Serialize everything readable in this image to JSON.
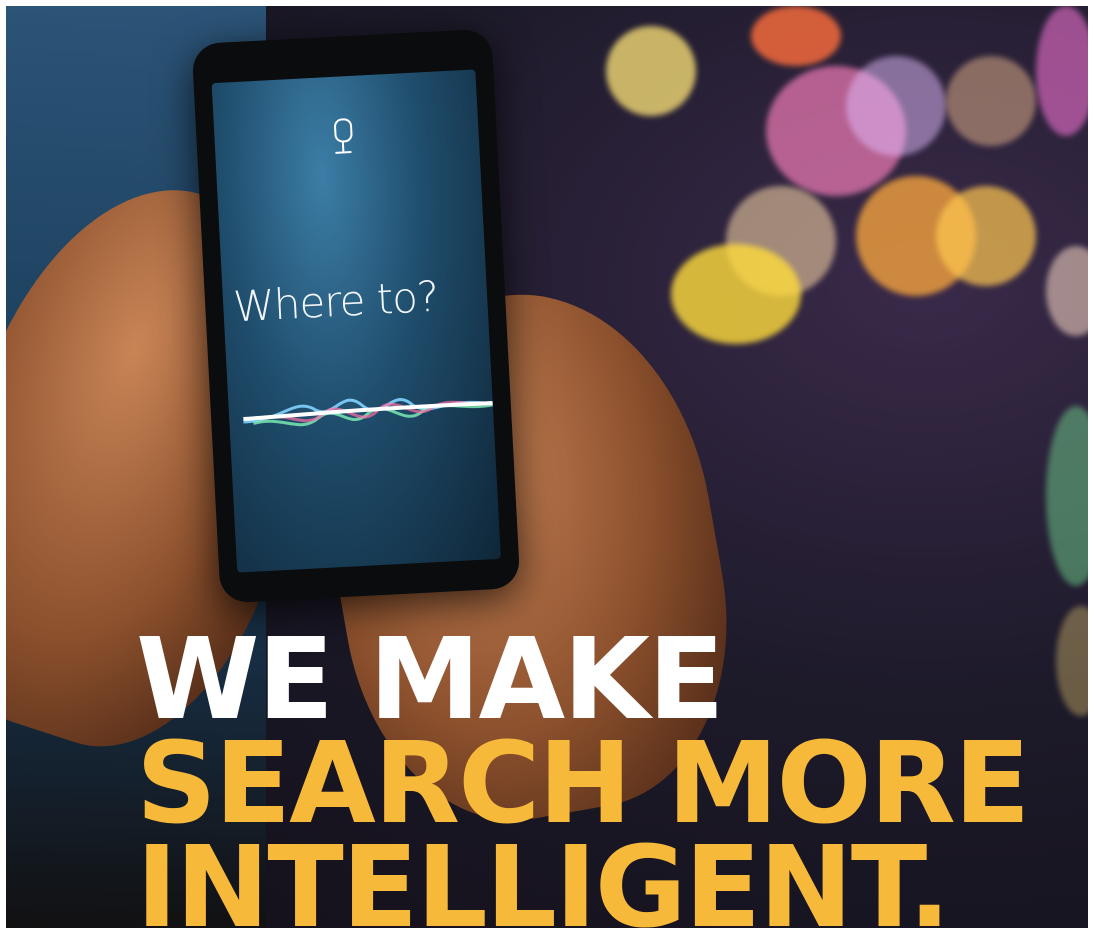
{
  "phone": {
    "prompt": "Where to?",
    "mic_icon": "microphone-icon",
    "wave_colors": [
      "#7fd3ff",
      "#4aa3ff",
      "#7ff2b6",
      "#ff6fa6",
      "#ffffff"
    ]
  },
  "headline": {
    "line1": "WE MAKE",
    "line2": "SEARCH MORE",
    "line3": "INTELLIGENT."
  },
  "colors": {
    "accent": "#f7b93a",
    "headline_white": "#ffffff"
  }
}
